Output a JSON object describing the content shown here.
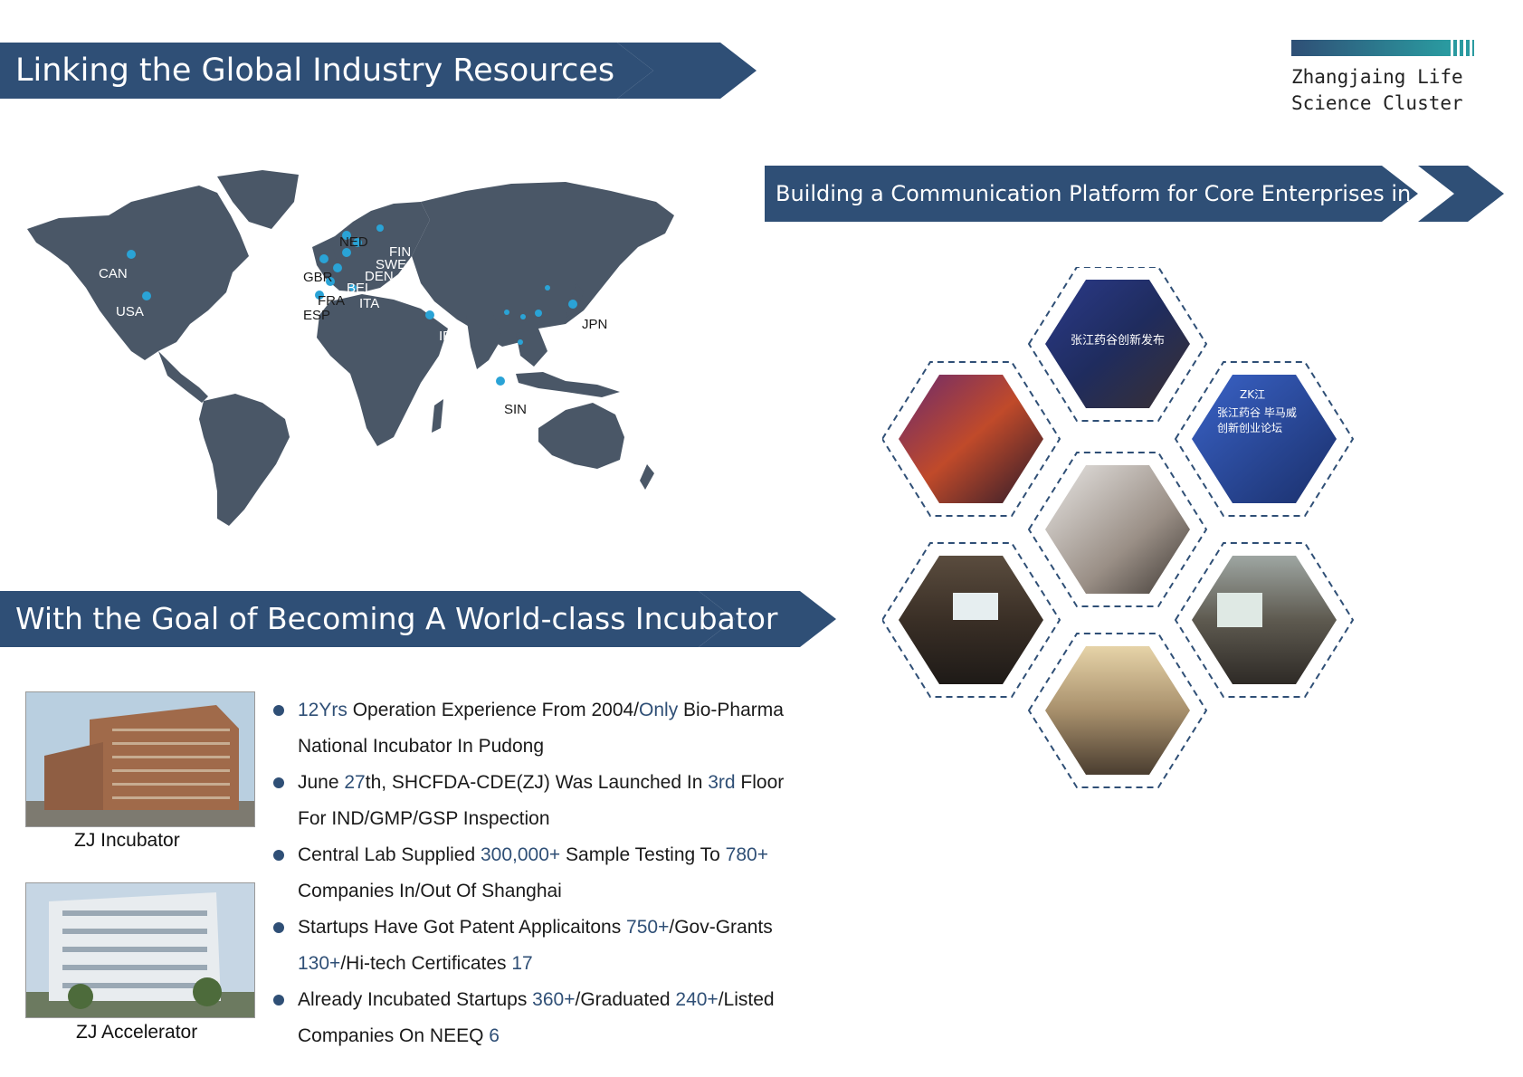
{
  "banners": {
    "global": "Linking the Global Industry Resources",
    "platform": "Building a Communication Platform for Core Enterprises in ZJ",
    "goal": "With the Goal of Becoming A World-class Incubator"
  },
  "logo": {
    "line1": "Zhangjaing Life",
    "line2": "Science Cluster"
  },
  "map": {
    "color": "#4a5767",
    "dot_color": "#2aa3d6",
    "labels": [
      "NED",
      "FIN",
      "SWE",
      "DEN",
      "CAN",
      "GBR",
      "BEL",
      "FRA",
      "ITA",
      "ESP",
      "USA",
      "IR",
      "JPN",
      "SIN"
    ]
  },
  "hex_images": {
    "top_center_text": "张江药谷创新发布",
    "right_top_text_1": "ZK江",
    "right_top_text_2": "张江药谷 毕马威",
    "right_top_text_3": "创新创业论坛"
  },
  "captions": {
    "incubator": "ZJ Incubator",
    "accelerator": "ZJ Accelerator"
  },
  "bullets": [
    {
      "parts": [
        {
          "t": "12Yrs",
          "hl": true
        },
        {
          "t": " Operation Experience From 2004/"
        },
        {
          "t": "Only",
          "hl": true
        },
        {
          "t": " Bio-Pharma"
        }
      ],
      "line2": "National Incubator In Pudong"
    },
    {
      "parts": [
        {
          "t": "June "
        },
        {
          "t": "27",
          "hl": true
        },
        {
          "t": "th, SHCFDA-CDE(ZJ) Was Launched In "
        },
        {
          "t": "3rd",
          "hl": true
        },
        {
          "t": " Floor"
        }
      ],
      "line2": "For IND/GMP/GSP Inspection"
    },
    {
      "parts": [
        {
          "t": "Central Lab Supplied "
        },
        {
          "t": "300,000+",
          "hl": true
        },
        {
          "t": " Sample Testing To "
        },
        {
          "t": "780+",
          "hl": true
        }
      ],
      "line2": "Companies In/Out Of Shanghai"
    },
    {
      "parts": [
        {
          "t": "Startups Have Got Patent Applicaitons "
        },
        {
          "t": "750+",
          "hl": true
        },
        {
          "t": "/Gov-Grants"
        }
      ],
      "line2parts": [
        {
          "t": "130+",
          "hl": true
        },
        {
          "t": "/Hi-tech Certificates "
        },
        {
          "t": "17",
          "hl": true
        }
      ]
    },
    {
      "parts": [
        {
          "t": "Already Incubated Startups "
        },
        {
          "t": "360+",
          "hl": true
        },
        {
          "t": "/Graduated "
        },
        {
          "t": "240+",
          "hl": true
        },
        {
          "t": "/Listed"
        }
      ],
      "line2parts": [
        {
          "t": "Companies On NEEQ  "
        },
        {
          "t": "6",
          "hl": true
        }
      ]
    }
  ]
}
